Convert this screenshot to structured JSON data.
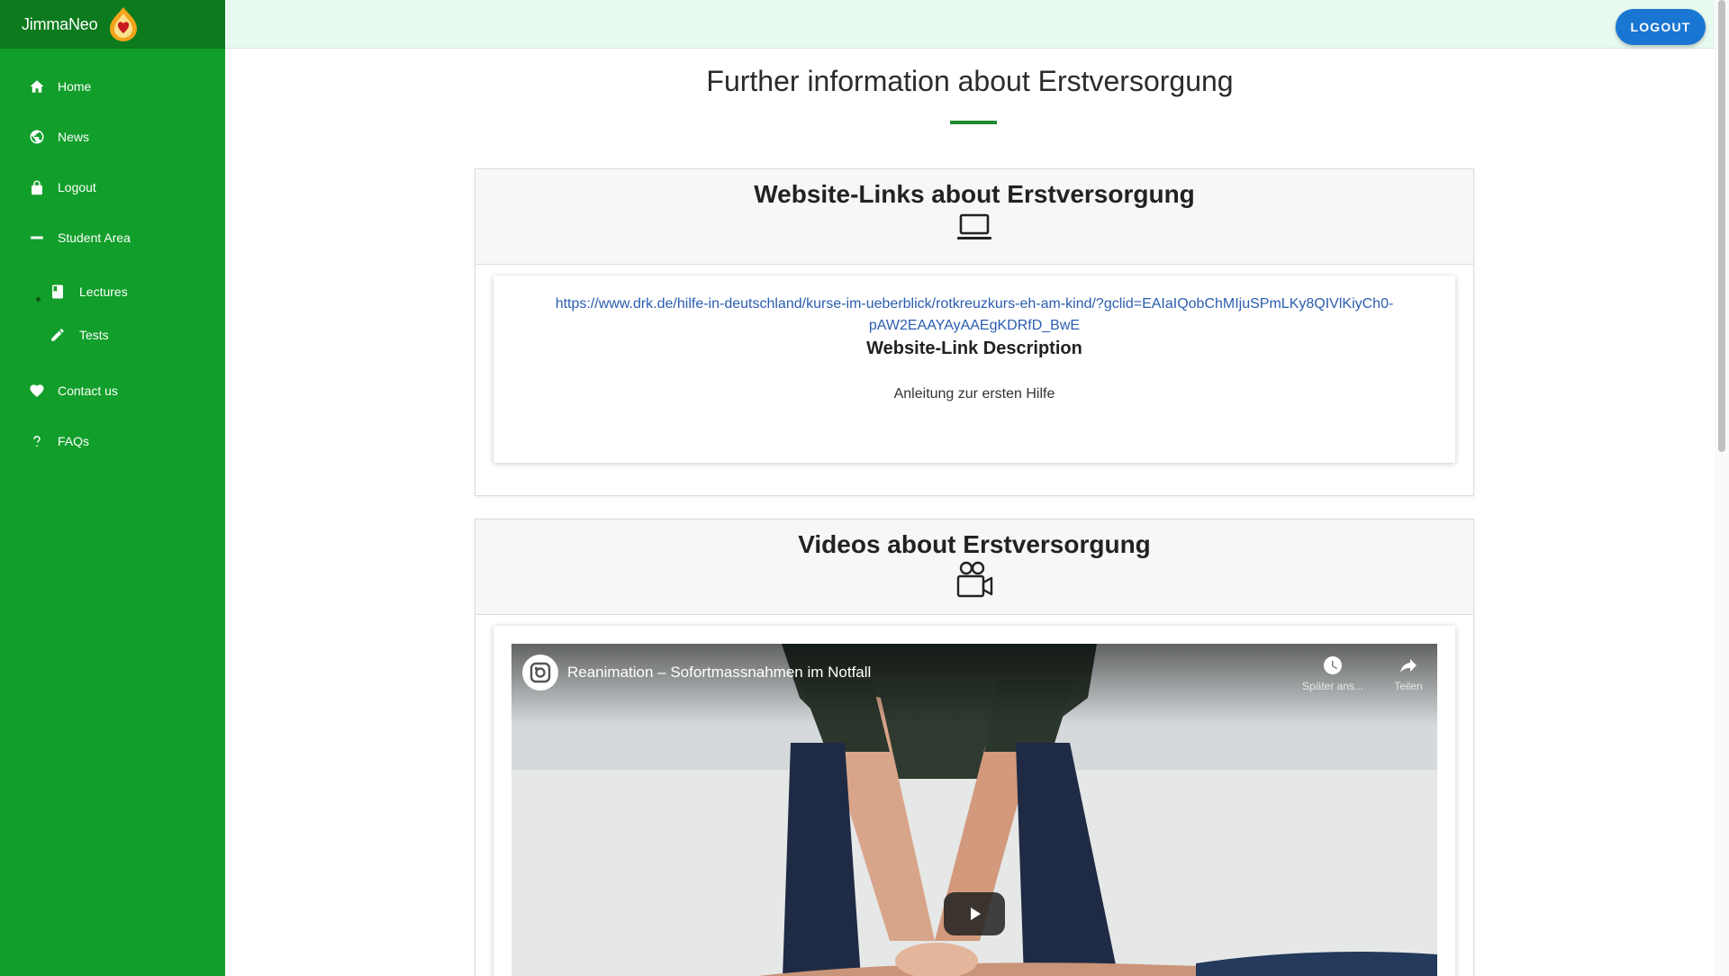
{
  "brand": {
    "name": "JimmaNeo"
  },
  "topbar": {
    "logout_label": "LOGOUT"
  },
  "sidebar": {
    "items": [
      {
        "label": "Home",
        "icon": "home-icon"
      },
      {
        "label": "News",
        "icon": "globe-icon"
      },
      {
        "label": "Logout",
        "icon": "lock-icon"
      },
      {
        "label": "Student Area",
        "icon": "minus-icon"
      }
    ],
    "subitems": [
      {
        "label": "Lectures",
        "icon": "book-icon"
      },
      {
        "label": "Tests",
        "icon": "pencil-icon"
      }
    ],
    "bottom_items": [
      {
        "label": "Contact us",
        "icon": "heart-icon"
      },
      {
        "label": "FAQs",
        "icon": "question-icon"
      }
    ]
  },
  "main": {
    "page_title": "Further information about Erstversorgung",
    "links_section": {
      "title": "Website-Links about Erstversorgung",
      "icon": "laptop-icon",
      "url": "https://www.drk.de/hilfe-in-deutschland/kurse-im-ueberblick/rotkreuzkurs-eh-am-kind/?gclid=EAIaIQobChMIjuSPmLKy8QIVlKiyCh0-pAW2EAAYAyAAEgKDRfD_BwE",
      "desc_title": "Website-Link Description",
      "desc": "Anleitung zur ersten Hilfe"
    },
    "videos_section": {
      "title": "Videos about Erstversorgung",
      "icon": "video-camera-icon",
      "video": {
        "title": "Reanimation – Sofortmassnahmen im Notfall",
        "watch_later": "Später ans...",
        "share": "Teilen"
      }
    }
  },
  "colors": {
    "sidebar": "#119e2a",
    "sidebar_brand": "#0c7a1d",
    "topbar": "#e8faf0",
    "accent_button": "#1976d2",
    "title_rule": "#1f8a30",
    "link": "#2a5db0"
  }
}
